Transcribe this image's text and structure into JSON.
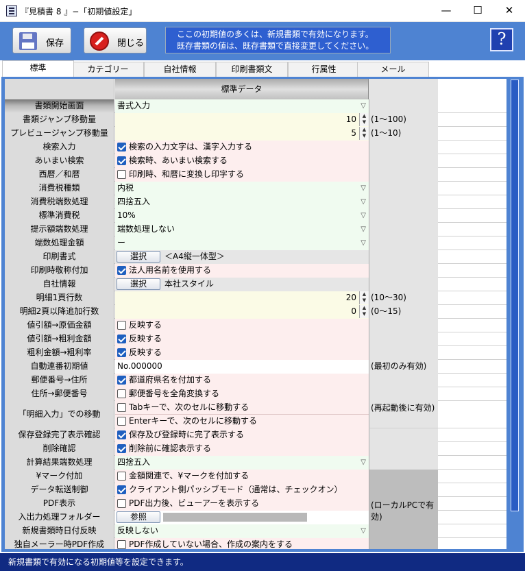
{
  "window": {
    "title": "『見積書 8 』−「初期値設定」",
    "minimize": "—",
    "maximize": "☐",
    "close": "✕"
  },
  "toolbar": {
    "save_label": "保存",
    "close_label": "閉じる",
    "info_line1": "ここの初期値の多くは、新規書類で有効になります。",
    "info_line2": "既存書類の値は、既存書類で直接変更してください。",
    "help_label": "?"
  },
  "tabs": [
    "標準",
    "カテゴリー",
    "自社情報",
    "印刷書類文",
    "行属性",
    "メール"
  ],
  "grid": {
    "header": "標準データ"
  },
  "rows": [
    {
      "label": "書類開始画面",
      "value": "書式入力"
    },
    {
      "label": "書類ジャンプ移動量",
      "value": "10",
      "note": "(1〜100)"
    },
    {
      "label": "プレビュージャンプ移動量",
      "value": "5",
      "note": "(1〜10)"
    },
    {
      "label": "検索入力",
      "value": "検索の入力文字は、漢字入力する"
    },
    {
      "label": "あいまい検索",
      "value": "検索時、あいまい検索する"
    },
    {
      "label": "西暦／和暦",
      "value": "印刷時、和暦に変換し印字する"
    },
    {
      "label": "消費税種類",
      "value": "内税"
    },
    {
      "label": "消費税端数処理",
      "value": "四捨五入"
    },
    {
      "label": "標準消費税",
      "value": "10%"
    },
    {
      "label": "提示額端数処理",
      "value": "端数処理しない"
    },
    {
      "label": "端数処理金額",
      "value": "ー"
    },
    {
      "label": "印刷書式",
      "button": "選択",
      "value": "＜A4縦一体型＞"
    },
    {
      "label": "印刷時敬称付加",
      "value": "法人用名前を使用する"
    },
    {
      "label": "自社情報",
      "button": "選択",
      "value": "本社スタイル"
    },
    {
      "label": "明細1頁行数",
      "value": "20",
      "note": "(10〜30)"
    },
    {
      "label": "明細2頁以降追加行数",
      "value": "0",
      "note": "(0〜15)"
    },
    {
      "label": "値引額→原価金額",
      "value": "反映する"
    },
    {
      "label": "値引額→粗利金額",
      "value": "反映する"
    },
    {
      "label": "粗利金額→粗利率",
      "value": "反映する"
    },
    {
      "label": "自動連番初期値",
      "value": "No.000000",
      "note": "(最初のみ有効)"
    },
    {
      "label": "郵便番号→住所",
      "value": "都道府県名を付加する"
    },
    {
      "label": "住所→郵便番号",
      "value": "郵便番号を全角変換する"
    },
    {
      "label": "「明細入力」での移動",
      "value": "Tabキーで、次のセルに移動する",
      "value2": "Enterキーで、次のセルに移動する",
      "note": "(再起動後に有効)"
    },
    {
      "label": "保存登録完了表示確認",
      "value": "保存及び登録時に完了表示する"
    },
    {
      "label": "削除確認",
      "value": "削除前に確認表示する"
    },
    {
      "label": "計算結果端数処理",
      "value": "四捨五入"
    },
    {
      "label": "¥マーク付加",
      "value": "金額関連で、¥マークを付加する"
    },
    {
      "label": "データ転送制御",
      "value": "クライアント側パッシブモード（通常は、チェックオン）"
    },
    {
      "label": "PDF表示",
      "value": "PDF出力後、ビューアーを表示する"
    },
    {
      "label": "入出力処理フォルダー",
      "button": "参照"
    },
    {
      "label": "新規書類時日付反映",
      "value": "反映しない"
    },
    {
      "label": "独自メーラー時PDF作成",
      "value": "PDF作成していない場合、作成の案内をする",
      "note": "(ローカルPCで有効)"
    }
  ],
  "checks": {
    "r3": true,
    "r4": true,
    "r5": false,
    "r12": true,
    "r16": false,
    "r17": true,
    "r18": true,
    "r20": true,
    "r21": false,
    "r22a": false,
    "r22b": false,
    "r23": true,
    "r24": true,
    "r26": false,
    "r27": true,
    "r28": false,
    "r31": false
  },
  "statusbar": {
    "text": "新規書類で有効になる初期値等を設定できます。"
  }
}
